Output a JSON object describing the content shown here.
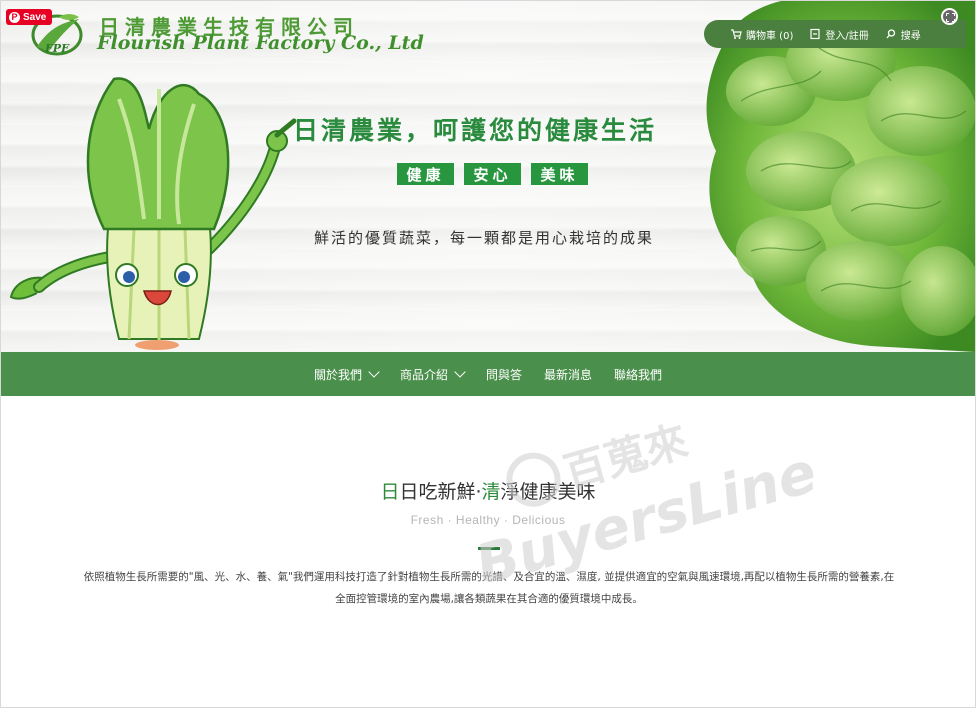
{
  "pinterest": {
    "save_label": "Save",
    "pin_glyph": "P"
  },
  "brand": {
    "logo_text": "FPF",
    "name_zh": "日清農業生技有限公司",
    "name_en": "Flourish Plant Factory Co., Ltd"
  },
  "topbar": {
    "cart_label": "購物車 (0)",
    "login_label": "登入/註冊",
    "search_label": "搜尋"
  },
  "hero": {
    "headline": "日清農業，呵護您的健康生活",
    "tags": [
      "健康",
      "安心",
      "美味"
    ],
    "subline": "鮮活的優質蔬菜，每一顆都是用心栽培的成果"
  },
  "nav": {
    "items": [
      {
        "label": "關於我們",
        "dropdown": true
      },
      {
        "label": "商品介紹",
        "dropdown": true
      },
      {
        "label": "問與答",
        "dropdown": false
      },
      {
        "label": "最新消息",
        "dropdown": false
      },
      {
        "label": "聯絡我們",
        "dropdown": false
      }
    ]
  },
  "section": {
    "title_accent_1": "日",
    "title_part_1": "日吃新鮮‧",
    "title_accent_2": "清",
    "title_part_2": "淨健康美味",
    "subtitle": "Fresh · Healthy · Delicious",
    "paragraph": "依照植物生長所需要的\"風、光、水、養、氣\"我們運用科技打造了針對植物生長所需的光譜、及合宜的溫、濕度, 並提供適宜的空氣與風速環境,再配以植物生長所需的營養素,在全面控管環境的室內農場,讓各類蔬果在其合適的優質環境中成長。"
  },
  "watermark": {
    "zh": "百蒐來",
    "en": "BuyersLine"
  },
  "colors": {
    "brand_green": "#4b8f4c",
    "tag_green": "#27963f",
    "headline_green": "#2a8b3e",
    "pin_red": "#e60023"
  }
}
